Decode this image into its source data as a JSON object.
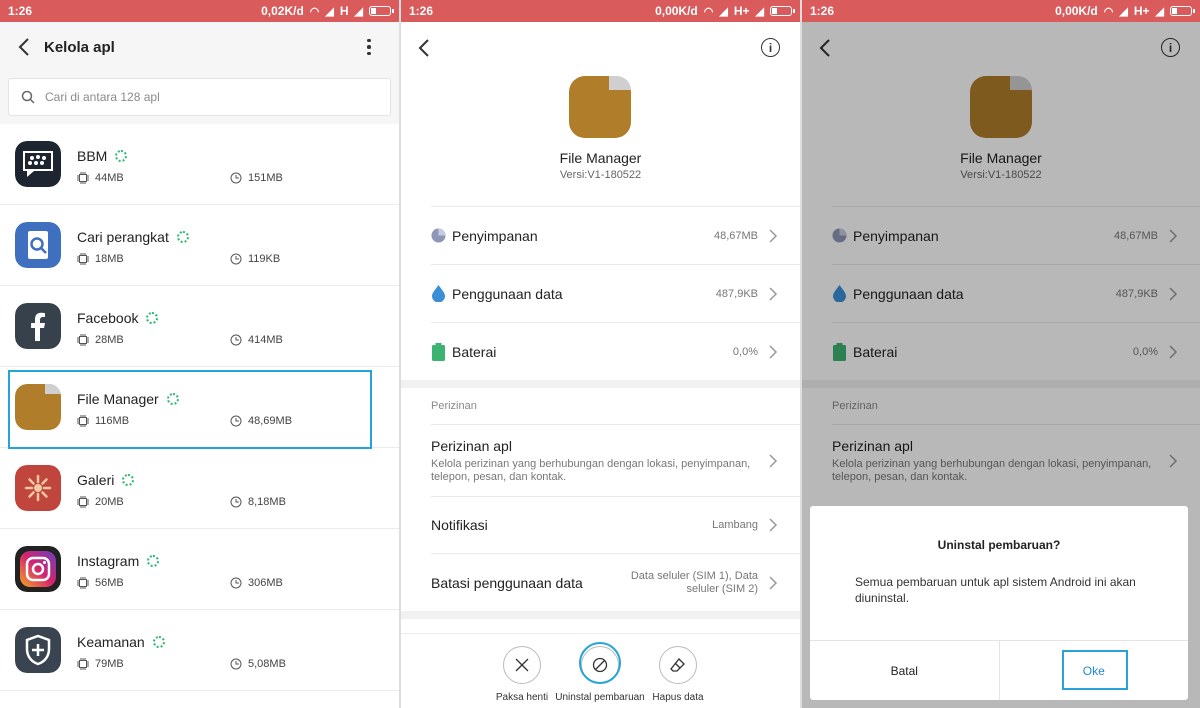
{
  "status": {
    "time": "1:26",
    "p1_speed": "0,02K/d",
    "p1_net": "H",
    "p23_speed": "0,00K/d",
    "p23_net": "H+"
  },
  "p1": {
    "title": "Kelola apl",
    "search_placeholder": "Cari di antara 128 apl",
    "apps": [
      {
        "name": "BBM",
        "app_size": "44MB",
        "data_size": "151MB"
      },
      {
        "name": "Cari perangkat",
        "app_size": "18MB",
        "data_size": "119KB"
      },
      {
        "name": "Facebook",
        "app_size": "28MB",
        "data_size": "414MB"
      },
      {
        "name": "File Manager",
        "app_size": "116MB",
        "data_size": "48,69MB"
      },
      {
        "name": "Galeri",
        "app_size": "20MB",
        "data_size": "8,18MB"
      },
      {
        "name": "Instagram",
        "app_size": "56MB",
        "data_size": "306MB"
      },
      {
        "name": "Keamanan",
        "app_size": "79MB",
        "data_size": "5,08MB"
      }
    ]
  },
  "detail": {
    "app_name": "File Manager",
    "version": "Versi:V1-180522",
    "storage_label": "Penyimpanan",
    "storage_value": "48,67MB",
    "data_label": "Penggunaan data",
    "data_value": "487,9KB",
    "battery_label": "Baterai",
    "battery_value": "0,0%",
    "section_perms": "Perizinan",
    "perms_label": "Perizinan apl",
    "perms_sub": "Kelola perizinan yang berhubungan dengan lokasi, penyimpanan, telepon, pesan, dan kontak.",
    "notif_label": "Notifikasi",
    "notif_value": "Lambang",
    "limit_label": "Batasi penggunaan data",
    "limit_value": "Data seluler (SIM 1), Data seluler (SIM 2)"
  },
  "actions": {
    "force_stop": "Paksa henti",
    "uninstall_updates": "Uninstal pembaruan",
    "clear_data": "Hapus data"
  },
  "dialog": {
    "title": "Uninstal pembaruan?",
    "message": "Semua pembaruan untuk apl sistem Android ini akan diuninstal.",
    "cancel": "Batal",
    "ok": "Oke"
  },
  "colors": {
    "status_bar": "#d95b5b",
    "highlight": "#27a3d9",
    "progress_dots": "#2bb673",
    "folder": "#b07d2a"
  }
}
